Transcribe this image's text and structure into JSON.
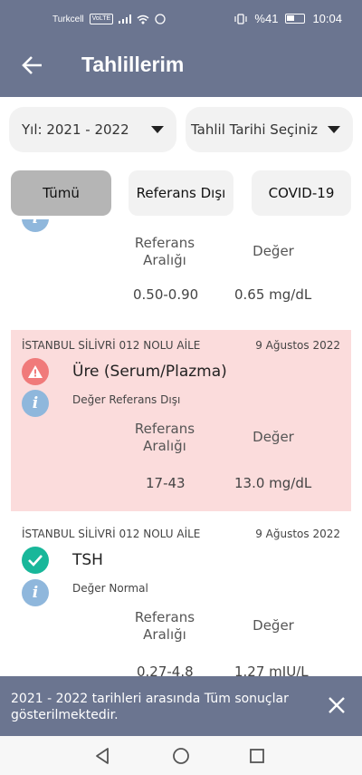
{
  "status_bar": {
    "carrier": "Turkcell",
    "volte": "VoLTE",
    "battery": "%41",
    "time": "10:04"
  },
  "app_bar": {
    "title": "Tahlillerim",
    "back_icon": "arrow-left-icon"
  },
  "filters": {
    "year_label": "Yıl: 2021 - 2022",
    "date_label": "Tahlil Tarihi Seçiniz"
  },
  "tabs": [
    {
      "label": "Tümü",
      "selected": true
    },
    {
      "label": "Referans Dışı",
      "selected": false
    },
    {
      "label": "COVID-19",
      "selected": false
    }
  ],
  "results": [
    {
      "clinic": "",
      "date": "",
      "name": "",
      "status": "",
      "ref_header": "Referans Aralığı",
      "value_header": "Değer",
      "ref_range": "0.50-0.90",
      "value": "0.65 mg/dL"
    },
    {
      "clinic": "İSTANBUL SİLİVRİ 012 NOLU AİLE",
      "date": "9 Ağustos 2022",
      "name": "Üre (Serum/Plazma)",
      "status": "Değer Referans Dışı",
      "status_icon": "warning-icon",
      "ref_header": "Referans Aralığı",
      "value_header": "Değer",
      "ref_range": "17-43",
      "value": "13.0 mg/dL",
      "highlight_color": "#fbdcdc"
    },
    {
      "clinic": "İSTANBUL SİLİVRİ 012 NOLU AİLE",
      "date": "9 Ağustos 2022",
      "name": "TSH",
      "status": "Değer Normal",
      "status_icon": "check-icon",
      "ref_header": "Referans Aralığı",
      "value_header": "Değer",
      "ref_range": "0.27-4.8",
      "value": "1.27 mIU/L"
    }
  ],
  "snackbar": {
    "message": "2021 - 2022 tarihleri arasında Tüm sonuçlar gösterilmektedir.",
    "close_icon": "close-icon"
  },
  "colors": {
    "primary": "#6b7590",
    "alert_bg": "#fbdcdc",
    "warning": "#f07a7a",
    "success": "#18b79a",
    "info": "#8fb7dc"
  }
}
